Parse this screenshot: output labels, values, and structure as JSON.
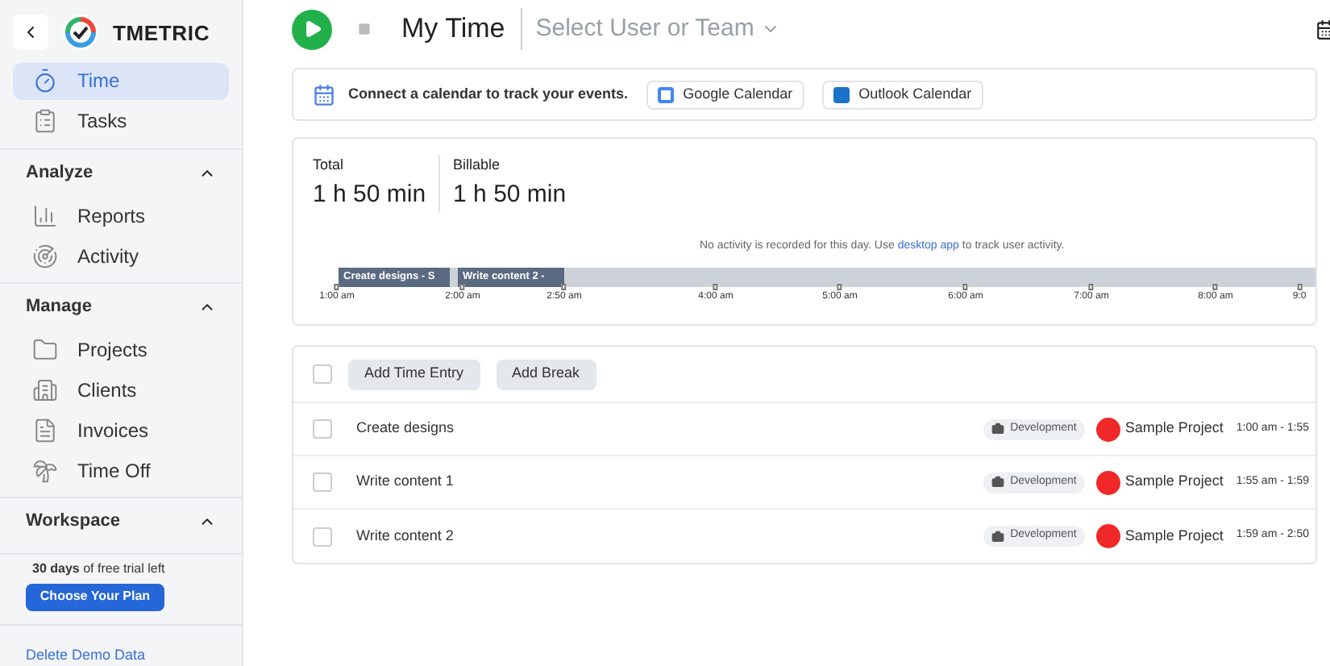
{
  "sidebar": {
    "logo": "TMETRIC",
    "top_items": [
      {
        "label": "Time",
        "selected": true
      },
      {
        "label": "Tasks",
        "selected": false
      }
    ],
    "sections": [
      {
        "title": "Analyze",
        "expanded": true,
        "items": [
          {
            "label": "Reports",
            "selected": false
          },
          {
            "label": "Activity",
            "selected": false
          }
        ]
      },
      {
        "title": "Manage",
        "expanded": true,
        "items": [
          {
            "label": "Projects",
            "selected": false
          },
          {
            "label": "Clients",
            "selected": false
          },
          {
            "label": "Invoices",
            "selected": false
          },
          {
            "label": "Time Off",
            "selected": false
          }
        ]
      },
      {
        "title": "Workspace",
        "expanded": true
      }
    ],
    "trial": "**30 days** of free trial left",
    "plan_button": "Choose Your Plan",
    "delete_link": "Delete Demo Data"
  },
  "header": {
    "title": "My Time",
    "user_select": "Select User or Team"
  },
  "calendar_banner": {
    "text": "Connect a calendar to track your events.",
    "buttons": [
      "Google Calendar",
      "Outlook Calendar"
    ]
  },
  "summary": [
    {
      "label": "Total",
      "value": "1 h 50 min"
    },
    {
      "label": "Billable",
      "value": "1 h 50 min"
    }
  ],
  "timeline": {
    "notice_before": "No activity is recorded for this day. Use",
    "notice_link": "desktop app",
    "notice_after": "to track user activity.",
    "segments": [
      "Create designs - S",
      "Write content 2 -"
    ],
    "ticks": [
      "1:00 am",
      "2:00 am",
      "2:50 am",
      "4:00 am",
      "5:00 am",
      "6:00 am",
      "7:00 am",
      "8:00 am",
      "9:0"
    ]
  },
  "entries": {
    "all_checked": false,
    "buttons": [
      "Add Time Entry",
      "Add Break"
    ],
    "rows": [
      {
        "checked": false,
        "name": "Create designs",
        "tag": "Development",
        "project": "Sample Project",
        "color": "#f02828",
        "time": "1:00 am - 1:55"
      },
      {
        "checked": false,
        "name": "Write content 1",
        "tag": "Development",
        "project": "Sample Project",
        "color": "#f02828",
        "time": "1:55 am - 1:59"
      },
      {
        "checked": false,
        "name": "Write content 2",
        "tag": "Development",
        "project": "Sample Project",
        "color": "#f02828",
        "time": "1:59 am - 2:50"
      }
    ]
  }
}
